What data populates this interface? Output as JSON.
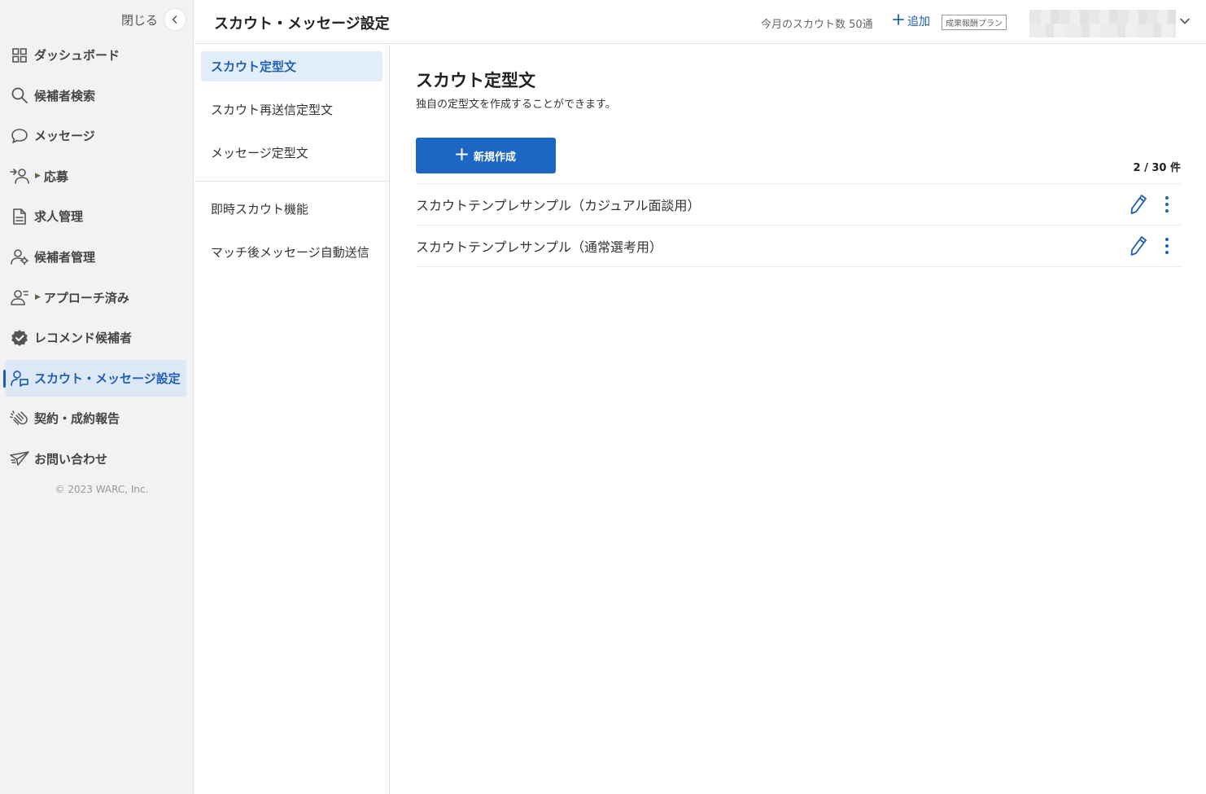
{
  "sidebar": {
    "close_label": "閉じる",
    "items": [
      {
        "label": "ダッシュボード",
        "icon": "dashboard-icon"
      },
      {
        "label": "候補者検索",
        "icon": "search-icon"
      },
      {
        "label": "メッセージ",
        "icon": "message-icon"
      },
      {
        "label": "応募",
        "icon": "application-icon"
      },
      {
        "label": "求人管理",
        "icon": "document-icon"
      },
      {
        "label": "候補者管理",
        "icon": "candidate-manage-icon"
      },
      {
        "label": "アプローチ済み",
        "icon": "approached-icon"
      },
      {
        "label": "レコメンド候補者",
        "icon": "verified-badge-icon"
      },
      {
        "label": "スカウト・メッセージ設定",
        "icon": "scout-settings-icon",
        "active": true
      },
      {
        "label": "契約・成約報告",
        "icon": "clap-icon"
      },
      {
        "label": "お問い合わせ",
        "icon": "paper-plane-icon"
      }
    ],
    "copyright": "© 2023 WARC, Inc."
  },
  "header": {
    "title": "スカウト・メッセージ設定",
    "scout_count": "今月のスカウト数 50通",
    "add_label": "追加",
    "plan_badge": "成果報酬プラン"
  },
  "subnav": {
    "items": [
      {
        "label": "スカウト定型文",
        "active": true
      },
      {
        "label": "スカウト再送信定型文"
      },
      {
        "label": "メッセージ定型文"
      },
      {
        "label": "即時スカウト機能"
      },
      {
        "label": "マッチ後メッセージ自動送信"
      }
    ]
  },
  "main": {
    "title": "スカウト定型文",
    "description": "独自の定型文を作成することができます。",
    "new_button": "新規作成",
    "count": "2 / 30 件",
    "templates": [
      {
        "name": "スカウトテンプレサンプル（カジュアル面談用）"
      },
      {
        "name": "スカウトテンプレサンプル（通常選考用）"
      }
    ]
  },
  "colors": {
    "accent": "#1e66c3",
    "active_text": "#1e5fb4",
    "active_bg": "#dde8f7",
    "sidebar_bg": "#f2f2f4"
  }
}
